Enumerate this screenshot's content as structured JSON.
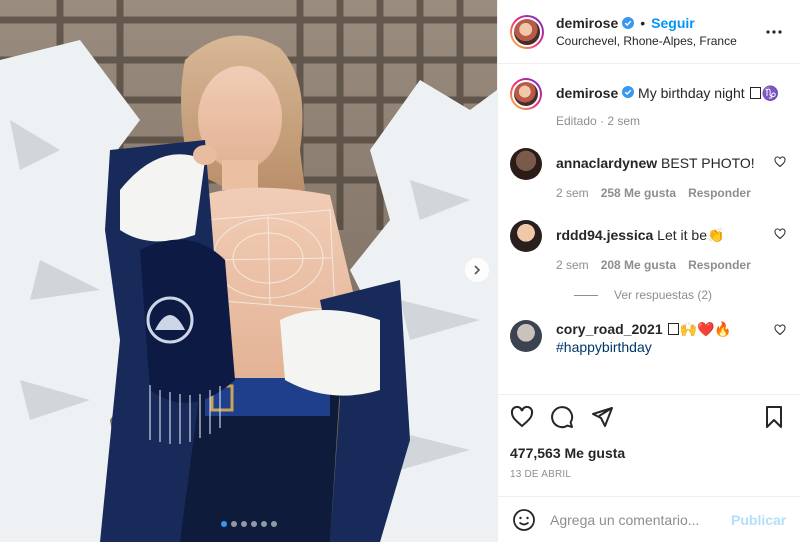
{
  "header": {
    "username": "demirose",
    "separator": "•",
    "follow_label": "Seguir",
    "location": "Courchevel, Rhone-Alpes, France"
  },
  "caption": {
    "username": "demirose",
    "text": "My birthday night",
    "emoji_after": "♑",
    "meta": "Editado · 2 sem"
  },
  "comments": [
    {
      "username": "annaclardynew",
      "text": "BEST PHOTO!",
      "time": "2 sem",
      "likes": "258 Me gusta",
      "reply": "Responder"
    },
    {
      "username": "rddd94.jessica",
      "text": "Let it be",
      "emoji_after": "👏",
      "time": "2 sem",
      "likes": "208 Me gusta",
      "reply": "Responder"
    },
    {
      "username": "cory_road_2021",
      "text": "",
      "emoji_after": "🙌❤️🔥",
      "hashtag": "#happybirthday"
    }
  ],
  "view_replies": "Ver respuestas (2)",
  "likes_count": "477,563 Me gusta",
  "post_date": "13 DE ABRIL",
  "composer": {
    "placeholder": "Agrega un comentario...",
    "publish_label": "Publicar"
  },
  "carousel": {
    "total": 6,
    "active_index": 0
  },
  "colors": {
    "accent": "#0095f6",
    "verified": "#3897f0",
    "muted": "#8e8e8e",
    "publish_disabled": "#b2dffc"
  },
  "icons": [
    "verified-icon",
    "more-icon",
    "heart-icon",
    "comment-icon",
    "share-icon",
    "bookmark-icon",
    "emoji-icon",
    "chevron-right-icon"
  ]
}
